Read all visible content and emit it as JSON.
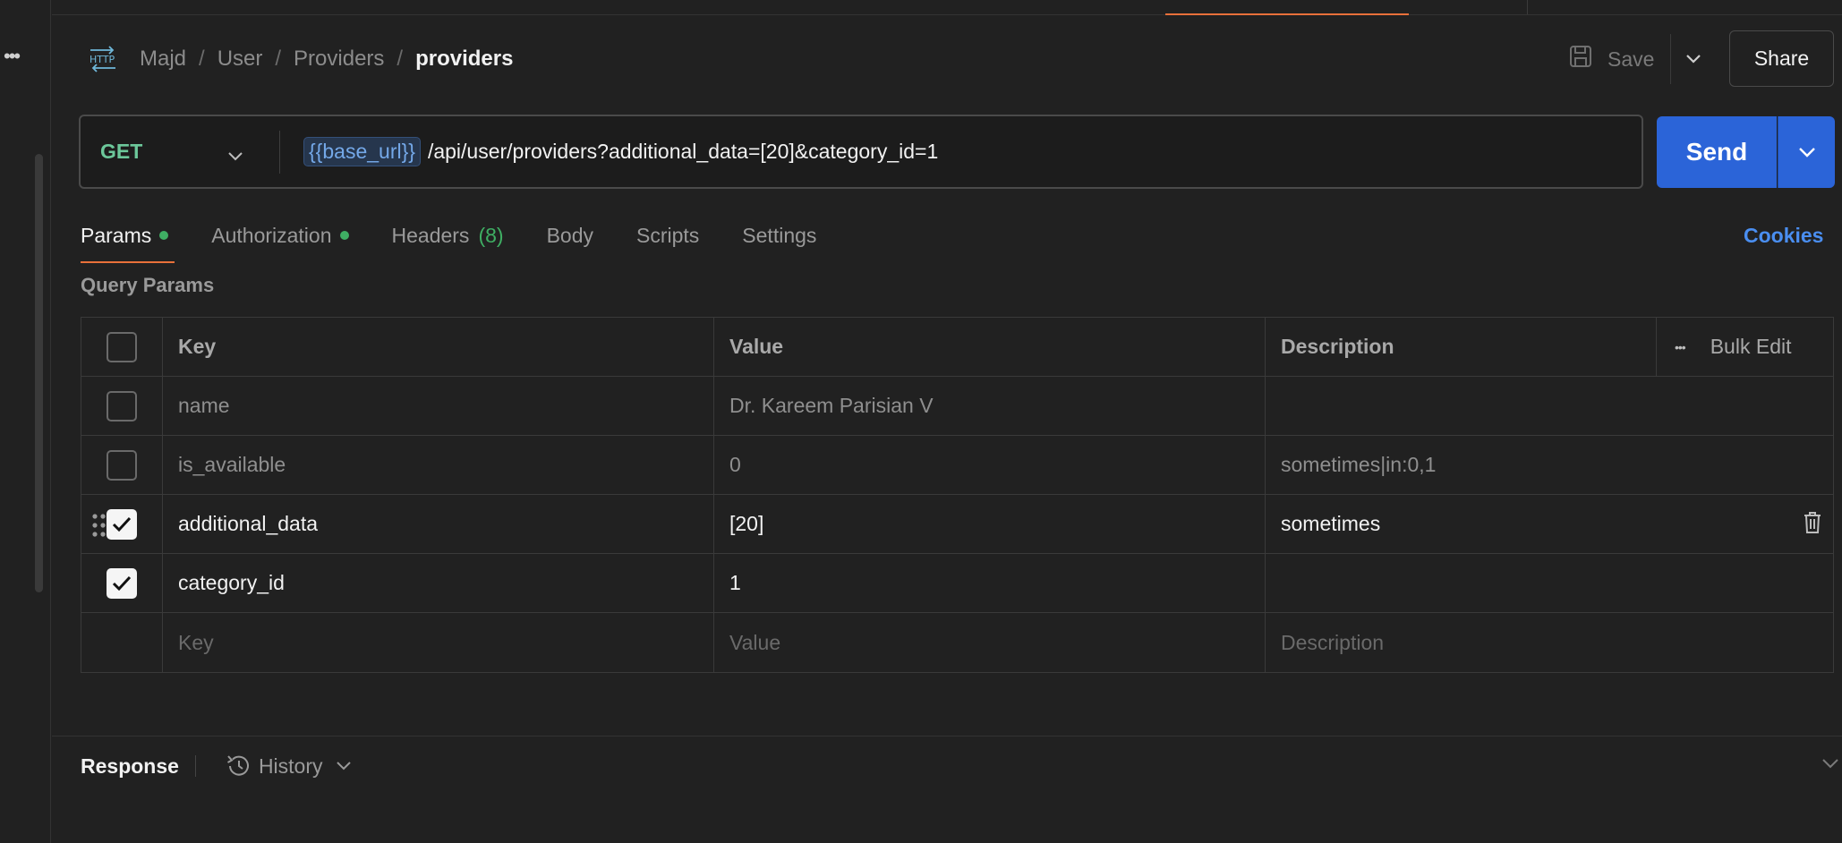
{
  "breadcrumb": {
    "items": [
      "Majd",
      "User",
      "Providers"
    ],
    "separator": "/",
    "current": "providers",
    "icon": "http-icon"
  },
  "toolbar": {
    "save_label": "Save",
    "share_label": "Share"
  },
  "request": {
    "method": "GET",
    "url_variable": "{{base_url}}",
    "url_path": "/api/user/providers?additional_data=[20]&category_id=1",
    "send_label": "Send"
  },
  "tabs": {
    "params": "Params",
    "authorization": "Authorization",
    "headers": "Headers",
    "headers_count": "(8)",
    "body": "Body",
    "scripts": "Scripts",
    "settings": "Settings",
    "cookies": "Cookies"
  },
  "query_params": {
    "title": "Query Params",
    "columns": {
      "key": "Key",
      "value": "Value",
      "description": "Description",
      "bulk_edit": "Bulk Edit"
    },
    "rows": [
      {
        "key": "name",
        "value": "Dr. Kareem Parisian V",
        "description": "",
        "checked": false
      },
      {
        "key": "is_available",
        "value": "0",
        "description": "sometimes|in:0,1",
        "checked": false
      },
      {
        "key": "additional_data",
        "value": "[20]",
        "description": "sometimes",
        "checked": true
      },
      {
        "key": "category_id",
        "value": "1",
        "description": "",
        "checked": true
      }
    ],
    "new_row": {
      "key_placeholder": "Key",
      "value_placeholder": "Value",
      "description_placeholder": "Description"
    }
  },
  "response": {
    "title": "Response",
    "history_label": "History"
  },
  "colors": {
    "accent": "#e8703a",
    "method_get": "#6cc79a",
    "send": "#2b64d8",
    "cookies": "#4a8ef0",
    "active_dot": "#3fae63"
  }
}
